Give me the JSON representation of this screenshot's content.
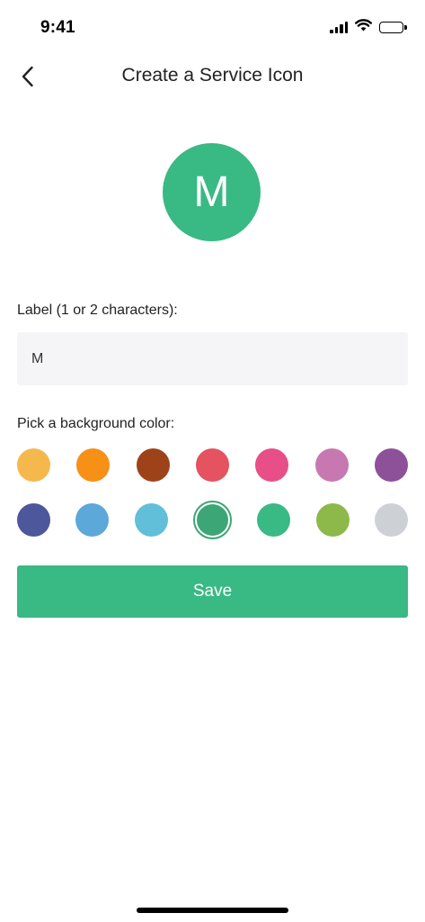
{
  "status": {
    "time": "9:41"
  },
  "header": {
    "title": "Create a Service Icon"
  },
  "avatar": {
    "letter": "M",
    "color": "#39B984"
  },
  "form": {
    "label_text": "Label (1 or 2 characters):",
    "label_value": "M",
    "color_text": "Pick a background color:"
  },
  "colors": {
    "row1": [
      "#F5B84D",
      "#F69016",
      "#9E4319",
      "#E55260",
      "#E84E87",
      "#C878B0",
      "#8C5199"
    ],
    "row2": [
      "#4D579B",
      "#5BA8D9",
      "#62BFDA",
      "#3DA676",
      "#39B984",
      "#8DB94B",
      "#CDD1D5"
    ],
    "selected": "#3DA676"
  },
  "save_label": "Save",
  "accent": "#39B984"
}
